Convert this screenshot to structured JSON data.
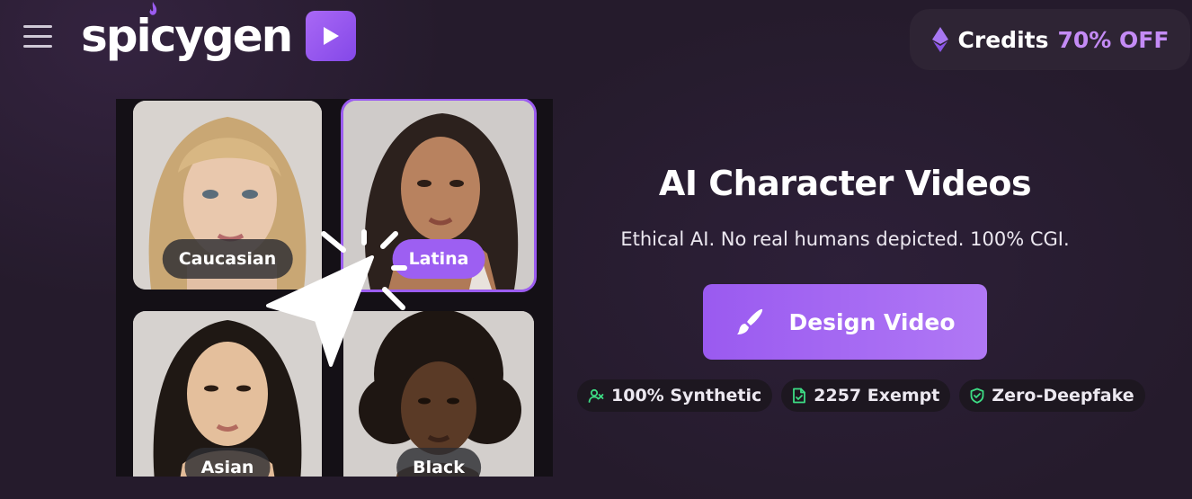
{
  "header": {
    "logo_text": "spicygen",
    "credits_label": "Credits",
    "credits_discount": "70% OFF"
  },
  "gallery": {
    "tiles": [
      {
        "label": "Caucasian"
      },
      {
        "label": "Latina"
      },
      {
        "label": "Asian"
      },
      {
        "label": "Black"
      }
    ]
  },
  "hero": {
    "title": "AI Character Videos",
    "subtitle": "Ethical AI. No real humans depicted. 100% CGI.",
    "cta_label": "Design Video"
  },
  "badges": [
    {
      "label": "100% Synthetic",
      "icon": "user-x-icon"
    },
    {
      "label": "2257 Exempt",
      "icon": "document-check-icon"
    },
    {
      "label": "Zero-Deepfake",
      "icon": "shield-check-icon"
    }
  ],
  "colors": {
    "accent": "#9b5cf0",
    "discount": "#c48bf5",
    "badge_icon": "#3ddc84",
    "background": "#251b2c"
  }
}
